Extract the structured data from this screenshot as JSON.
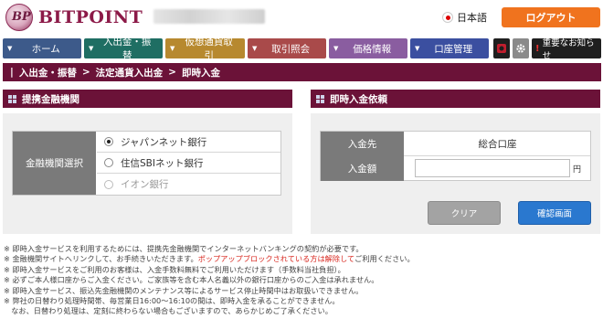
{
  "header": {
    "logo_mark": "BP",
    "logo_text": "BITPOINT",
    "language_label": "日本語",
    "logout_label": "ログアウト"
  },
  "nav": {
    "items": [
      {
        "label": "ホーム",
        "color": "#3d5a8a"
      },
      {
        "label": "入出金・振替",
        "color": "#1f6e63"
      },
      {
        "label": "仮想通貨取引",
        "color": "#b7892f"
      },
      {
        "label": "取引照会",
        "color": "#a94a4a"
      },
      {
        "label": "価格情報",
        "color": "#8a5da0"
      },
      {
        "label": "口座管理",
        "color": "#3b4fa0"
      }
    ],
    "notice_label": "重要なお知らせ",
    "notice_mark": "!"
  },
  "breadcrumb": {
    "items": [
      "入出金・振替",
      "法定通貨入出金",
      "即時入金"
    ],
    "separator": ">"
  },
  "left_panel": {
    "title": "提携金融機関",
    "row_label": "金融機関選択",
    "options": [
      {
        "label": "ジャパンネット銀行",
        "selected": true
      },
      {
        "label": "住信SBIネット銀行",
        "selected": false
      },
      {
        "label": "イオン銀行",
        "selected": false
      }
    ]
  },
  "right_panel": {
    "title": "即時入金依頼",
    "destination_label": "入金先",
    "destination_value": "総合口座",
    "amount_label": "入金額",
    "amount_value": "",
    "amount_unit": "円",
    "clear_label": "クリア",
    "confirm_label": "確認画面"
  },
  "notes": [
    {
      "text": "※ 即時入金サービスを利用するためには、提携先金融機関でインターネットバンキングの契約が必要です。"
    },
    {
      "text": "※ 金融機関サイトへリンクして、お手続きいただきます。",
      "red": "ポップアップブロックされている方は解除して",
      "after": "ご利用ください。"
    },
    {
      "text": "※ 即時入金サービスをご利用のお客様は、入金手数料無料でご利用いただけます（手数料当社負担）。"
    },
    {
      "text": "※ 必ずご本人様口座からご入金ください。ご家族等を含む本人名義以外の銀行口座からのご入金は承れません。"
    },
    {
      "text": "※ 即時入金サービス、振込先金融機関のメンテナンス等によるサービス停止時間中はお取扱いできません。"
    },
    {
      "text": "※ 弊社の日替わり処理時間帯、毎営業日16:00～16:10の間は、即時入金を承ることができません。"
    },
    {
      "text": "　なお、日替わり処理は、定刻に終わらない場合もございますので、あらかじめご了承ください。"
    }
  ]
}
